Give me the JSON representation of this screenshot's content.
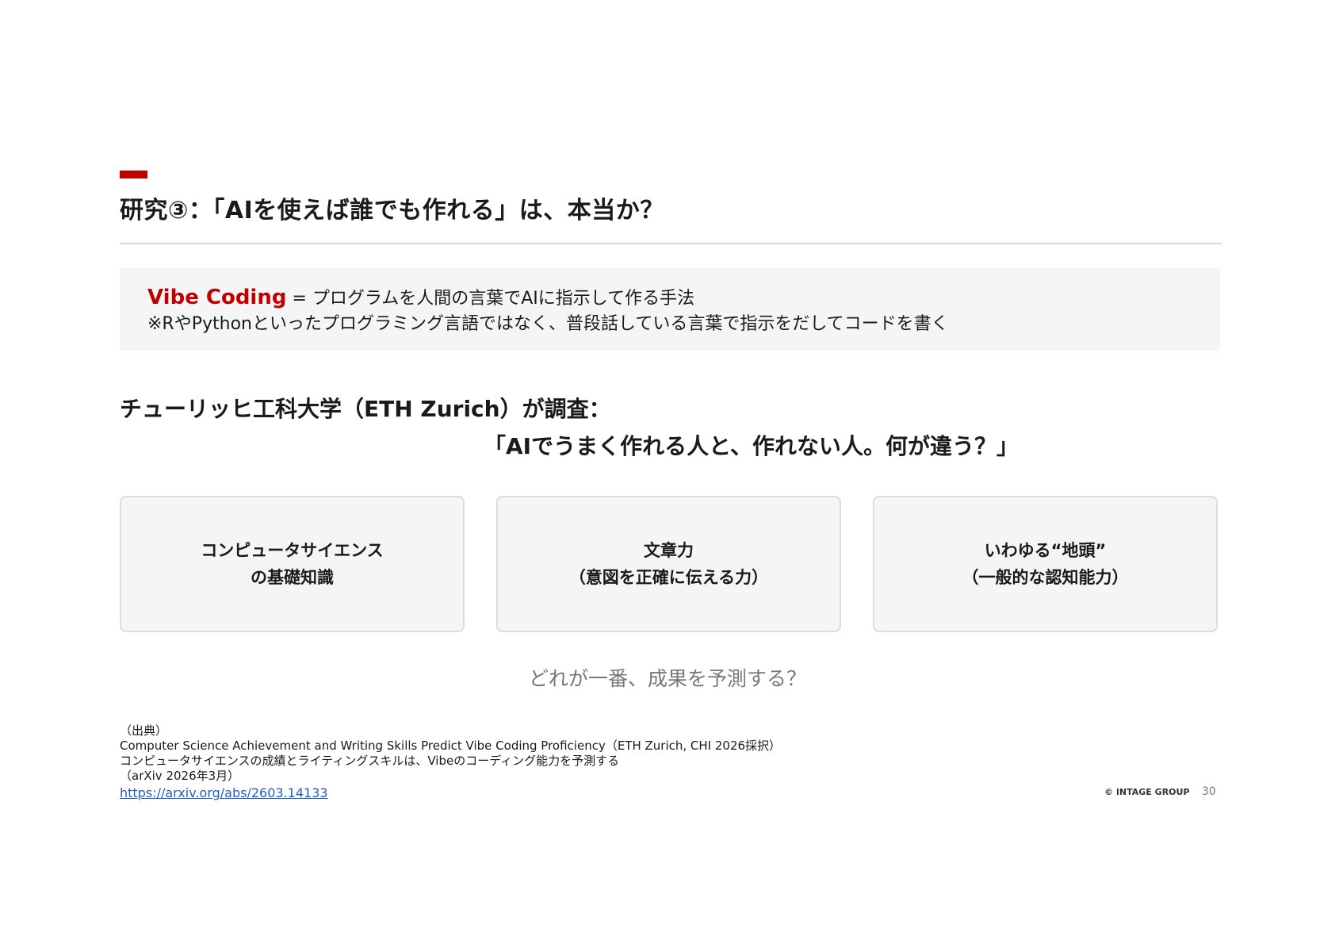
{
  "colors": {
    "accent": "#c00000",
    "card_bg": "#f5f5f5",
    "text": "#1a1a1a",
    "muted": "#777777",
    "link": "#1f5fbf"
  },
  "header": {
    "title": "研究③：「AIを使えば誰でも作れる」は、本当か？"
  },
  "definition": {
    "term": "Vibe Coding",
    "definition": " = プログラムを人間の言葉でAIに指示して作る手法",
    "note": "※RやPythonといったプログラミング言語ではなく、普段話している言葉で指示をだしてコードを書く"
  },
  "study": {
    "intro": "チューリッヒ工科大学（ETH Zurich）が調査：",
    "question": "「AIでうまく作れる人と、作れない人。何が違う？」"
  },
  "cards": [
    {
      "line1": "コンピュータサイエンス",
      "line2": "の基礎知識"
    },
    {
      "line1": "文章力",
      "line2": "（意図を正確に伝える力）"
    },
    {
      "line1": "いわゆる“地頭”",
      "line2": "（一般的な認知能力）"
    }
  ],
  "prompt": "どれが一番、成果を予測する？",
  "source": {
    "label": "（出典）",
    "paper_title": "Computer Science Achievement and Writing Skills Predict Vibe Coding Proficiency（ETH Zurich, CHI 2026採択）",
    "paper_title_ja": "コンピュータサイエンスの成績とライティングスキルは、Vibeのコーディング能力を予測する",
    "venue": "（arXiv 2026年3月）",
    "url": "https://arxiv.org/abs/2603.14133"
  },
  "footer": {
    "copyright": "© INTAGE GROUP",
    "page_number": "30"
  }
}
